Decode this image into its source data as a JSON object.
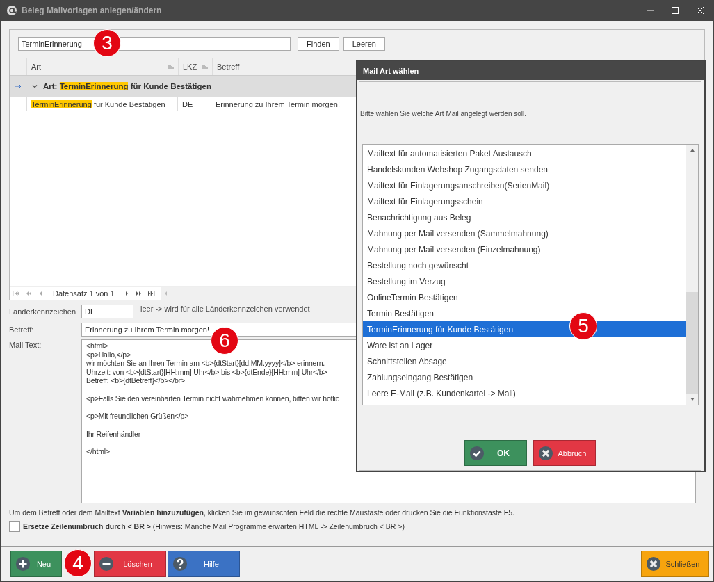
{
  "window": {
    "title": "Beleg Mailvorlagen anlegen/ändern"
  },
  "search": {
    "value": "TerminErinnerung",
    "buttons": [
      "Finden",
      "Leeren"
    ]
  },
  "grid": {
    "columns": [
      "Art",
      "LKZ",
      "Betreff"
    ],
    "group": {
      "prefix": "Art:",
      "highlight": "TerminErinnerung",
      "rest": " für Kunde Bestätigen",
      "expanded": true
    },
    "rows": [
      {
        "art_highlight": "TerminErinnerung",
        "art_rest": " für Kunde Bestätigen",
        "lkz": "DE",
        "betreff": "Erinnerung zu Ihrem Termin morgen!"
      }
    ],
    "navigator": "Datensatz 1 von 1"
  },
  "form": {
    "country_label": "Länderkennzeichen",
    "country_value": "DE",
    "country_hint": "leer -> wird für alle Länderkennzeichen verwendet",
    "subject_label": "Betreff:",
    "subject_value": "Erinnerung zu Ihrem Termin morgen!",
    "mailtext_label": "Mail Text:",
    "mailtext_paragraphs": [
      [
        "<html>",
        "<p>Hallo,</p>",
        "wir möchten Sie an Ihren Termin am <b>{dtStart}[dd.MM.yyyy]</b> erinnern.",
        "Uhrzeit: von <b>{dtStart}[HH:mm] Uhr</b> bis <b>{dtEnde}[HH:mm] Uhr</b>",
        "Betreff: <b>{dtBetreff}</b></br>"
      ],
      [
        "<p>Falls Sie den vereinbarten Termin nicht wahrnehmen können, bitten wir höflic"
      ],
      [
        "<p>Mit freundlichen Grüßen</p>"
      ],
      [
        "Ihr Reifenhändler"
      ],
      [
        "</html>"
      ]
    ]
  },
  "hint": "Um dem Betreff oder dem Mailtext **Variablen hinzuzufügen**, klicken Sie im gewünschten Feld die rechte Maustaste oder drücken Sie die Funktionstaste F5.",
  "replace_br": {
    "checked": false,
    "label": "**Ersetze Zeilenumbruch durch < BR >** (Hinweis: Manche Mail Programme erwarten HTML -> Zeilenumbruch < BR >)"
  },
  "footer_buttons": [
    {
      "label": "Neu",
      "kind": "add"
    },
    {
      "label": "Löschen",
      "kind": "delete"
    },
    {
      "label": "Hilfe",
      "kind": "help"
    },
    {
      "label": "Schließen",
      "kind": "close"
    }
  ],
  "dialog": {
    "title": "Mail Art wählen",
    "prompt": "Bitte wählen Sie welche Art Mail angelegt werden soll.",
    "items": [
      {
        "label": "Mailtext für automatisierten Paket Austausch",
        "selected": false
      },
      {
        "label": "Handelskunden Webshop Zugangsdaten senden",
        "selected": false
      },
      {
        "label": "Mailtext für Einlagerungsanschreiben(SerienMail)",
        "selected": false
      },
      {
        "label": "Mailtext für Einlagerungsschein",
        "selected": false
      },
      {
        "label": "Benachrichtigung aus Beleg",
        "selected": false
      },
      {
        "label": "Mahnung per Mail versenden (Sammelmahnung)",
        "selected": false
      },
      {
        "label": "Mahnung per Mail versenden (Einzelmahnung)",
        "selected": false
      },
      {
        "label": "Bestellung noch gewünscht",
        "selected": false
      },
      {
        "label": "Bestellung im Verzug",
        "selected": false
      },
      {
        "label": "OnlineTermin Bestätigen",
        "selected": false
      },
      {
        "label": "Termin Bestätigen",
        "selected": false
      },
      {
        "label": "TerminErinnerung für Kunde Bestätigen",
        "selected": true
      },
      {
        "label": "Ware ist an Lager",
        "selected": false
      },
      {
        "label": "Schnittstellen Absage",
        "selected": false
      },
      {
        "label": "Zahlungseingang Bestätigen",
        "selected": false
      },
      {
        "label": "Leere E-Mail (z.B. Kundenkartei -> Mail)",
        "selected": false
      }
    ],
    "buttons": [
      {
        "label": "OK",
        "kind": "ok"
      },
      {
        "label": "Abbruch",
        "kind": "cancel"
      }
    ]
  },
  "callouts": [
    "3",
    "4",
    "5",
    "6"
  ]
}
